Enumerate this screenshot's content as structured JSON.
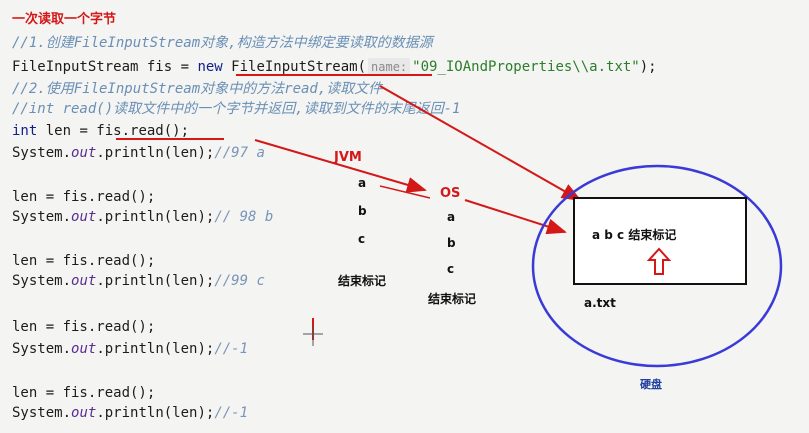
{
  "title": "一次读取一个字节",
  "code": {
    "line1": "//1.创建FileInputStream对象,构造方法中绑定要读取的数据源",
    "line2_a": "FileInputStream fis = ",
    "line2_kw": "new",
    "line2_b": " FileInputStream(",
    "line2_hint": "name:",
    "line2_str": "\"09_IOAndProperties\\\\a.txt\"",
    "line2_c": ");",
    "line3": "//2.使用FileInputStream对象中的方法read,读取文件",
    "line4": "//int read()读取文件中的一个字节并返回,读取到文件的末尾返回-1",
    "line5_kw": "int",
    "line5_rest": " len = fis.read();",
    "println_a": "System.",
    "println_out": "out",
    "println_b": ".println(len);",
    "c97": "//97 a",
    "read_line": "len = fis.read();",
    "c98": "// 98 b",
    "c99": "//99 c",
    "cm1": "//-1",
    "cm1b": "//-1"
  },
  "labels": {
    "jvm": "JVM",
    "os": "OS",
    "jvm_chars": [
      "a",
      "b",
      "c"
    ],
    "jvm_end": "结束标记",
    "os_chars": [
      "a",
      "b",
      "c"
    ],
    "os_end": "结束标记",
    "file_content": "a b c 结束标记",
    "file_name": "a.txt",
    "disk": "硬盘"
  },
  "colors": {
    "annotation_red": "#d41818",
    "disk_circle": "#3a3ad8"
  }
}
